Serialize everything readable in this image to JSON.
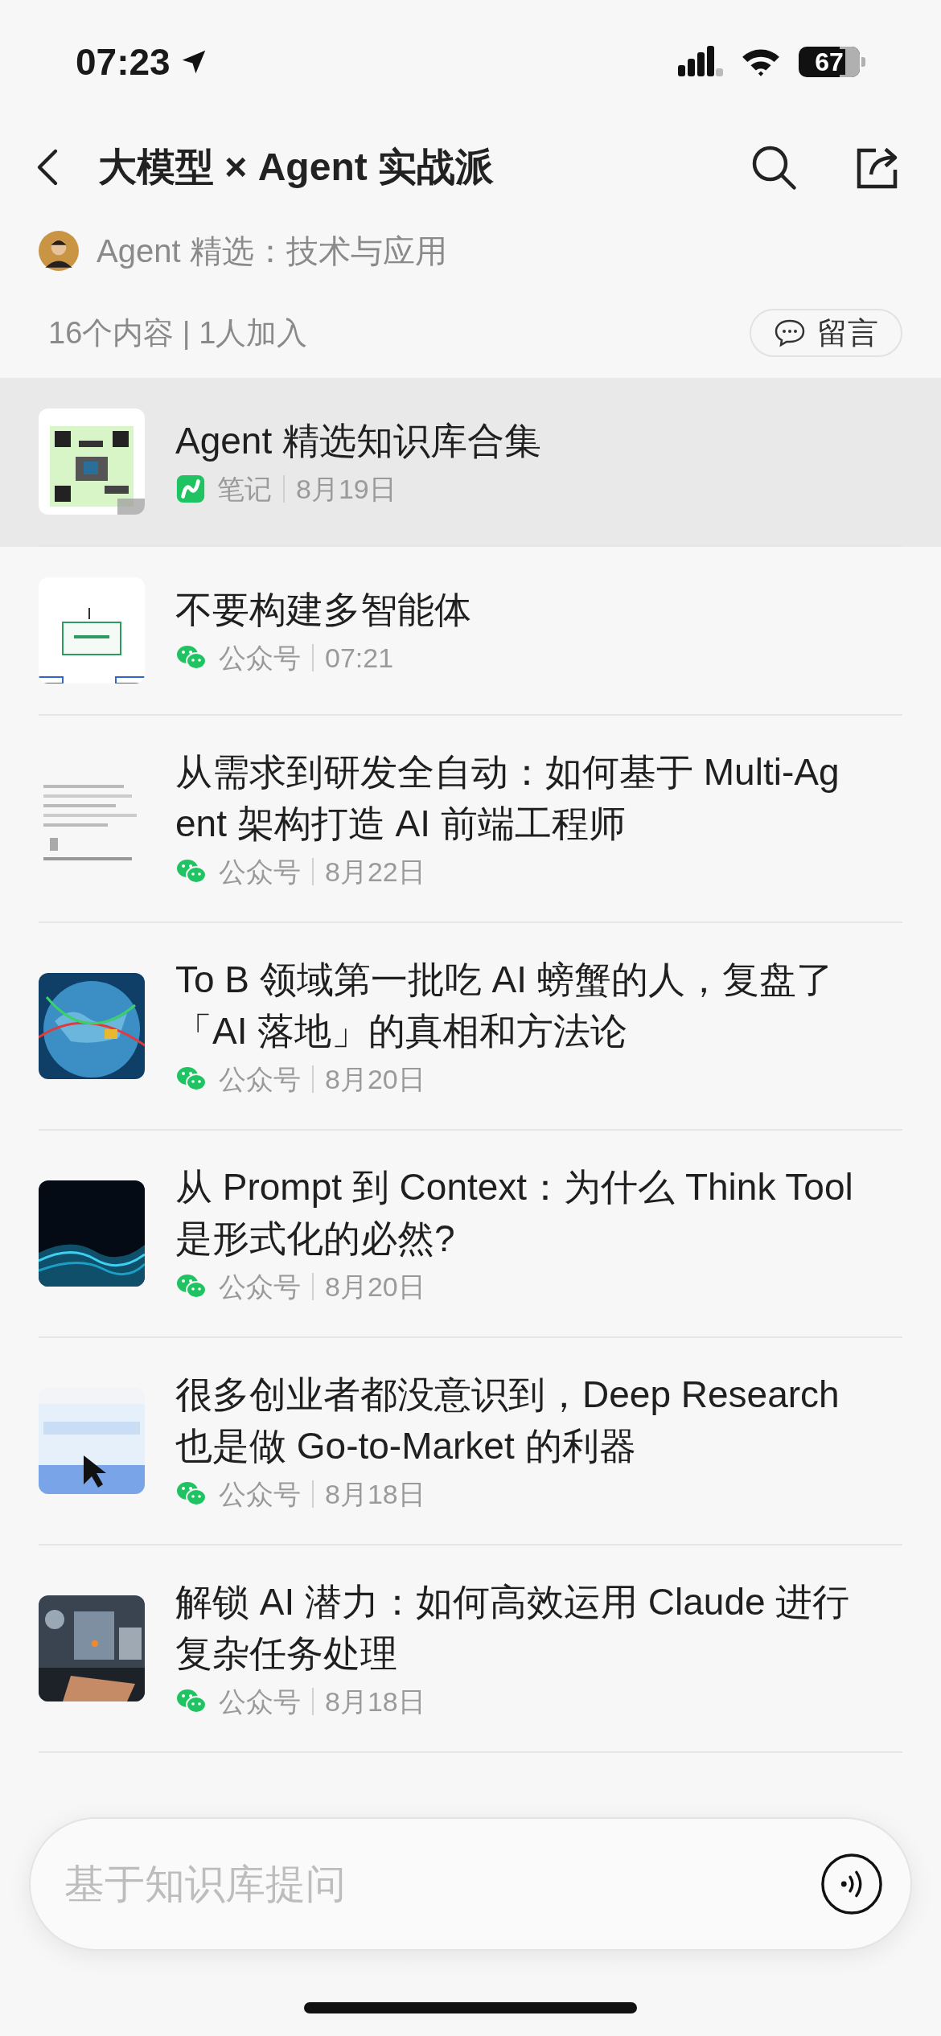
{
  "status_bar": {
    "time": "07:23",
    "battery": "67"
  },
  "header": {
    "title": "大模型 × Agent 实战派"
  },
  "owner": {
    "name": "Agent 精选：技术与应用"
  },
  "stats": {
    "text": "16个内容 | 1人加入",
    "comment_button": "留言"
  },
  "items": [
    {
      "title_lines": [
        "Agent 精选知识库合集"
      ],
      "kind": "note",
      "source": "笔记",
      "date": "8月19日",
      "selected": true
    },
    {
      "title_lines": [
        "不要构建多智能体"
      ],
      "kind": "official_account",
      "source": "公众号",
      "date": "07:21",
      "selected": false
    },
    {
      "title_lines": [
        "从需求到研发全自动：如何基于 Multi-Ag",
        "ent 架构打造 AI 前端工程师"
      ],
      "kind": "official_account",
      "source": "公众号",
      "date": "8月22日",
      "selected": false
    },
    {
      "title_lines": [
        "To B 领域第一批吃 AI 螃蟹的人，复盘了",
        "「AI 落地」的真相和方法论"
      ],
      "kind": "official_account",
      "source": "公众号",
      "date": "8月20日",
      "selected": false
    },
    {
      "title_lines": [
        "从 Prompt 到 Context：为什么 Think Tool",
        "是形式化的必然?"
      ],
      "kind": "official_account",
      "source": "公众号",
      "date": "8月20日",
      "selected": false
    },
    {
      "title_lines": [
        "很多创业者都没意识到，Deep Research",
        "也是做 Go-to-Market 的利器"
      ],
      "kind": "official_account",
      "source": "公众号",
      "date": "8月18日",
      "selected": false
    },
    {
      "title_lines": [
        "解锁 AI 潜力：如何高效运用 Claude 进行",
        "复杂任务处理"
      ],
      "kind": "official_account",
      "source": "公众号",
      "date": "8月18日",
      "selected": false
    }
  ],
  "ask_bar": {
    "placeholder": "基于知识库提问"
  }
}
